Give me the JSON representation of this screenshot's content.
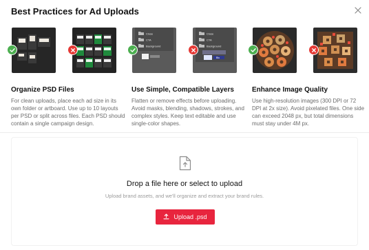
{
  "dialog": {
    "title": "Best Practices for Ad Uploads"
  },
  "practices": [
    {
      "heading": "Organize PSD Files",
      "body": "For clean uploads, place each ad size in its own folder or artboard. Use up to 10 layouts per PSD or split across files. Each PSD should contain a single campaign design."
    },
    {
      "heading": "Use Simple, Compatible Layers",
      "body": "Flatten or remove effects before uploading. Avoid masks, blending, shadows, strokes, and complex styles. Keep text editable and use single-color shapes."
    },
    {
      "heading": "Enhance Image Quality",
      "body": "Use high-resolution images (300 DPI or 72 DPI at 2x size). Avoid pixelated files. One side can exceed 2048 px, but total dimensions must stay under 4M px."
    }
  ],
  "layers_good": [
    "Close",
    "CTA",
    "Background"
  ],
  "layers_bad": [
    "Close",
    "CTA",
    "Background",
    "Blu"
  ],
  "upload": {
    "title": "Drop a file here or select to upload",
    "subtitle": "Upload brand assets, and we'll organize and extract your brand rules.",
    "button_label": "Upload .psd"
  },
  "colors": {
    "accent": "#e8253e",
    "good": "#4caf50",
    "bad": "#e53935"
  },
  "icons": {
    "close": "close-icon",
    "good": "check-icon",
    "bad": "x-icon",
    "upload": "upload-icon",
    "file": "file-upload-icon"
  }
}
